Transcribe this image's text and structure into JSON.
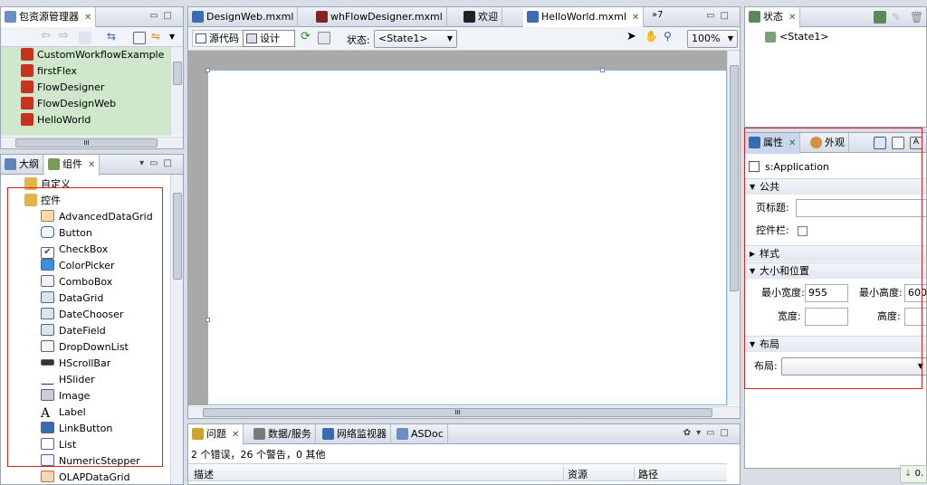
{
  "colors": {
    "selection_green": "#cfe7cb",
    "accent_red": "#e02020",
    "flex_red": "#c8321e",
    "folder": "#e3b34a"
  },
  "package_explorer": {
    "title": "包资源管理器",
    "items": [
      "CustomWorkflowExample",
      "firstFlex",
      "FlowDesigner",
      "FlowDesignWeb",
      "HelloWorld"
    ],
    "hscroll_label": "III"
  },
  "outline_panel": {
    "tabs": [
      "大纲",
      "组件"
    ],
    "folders": [
      "自定义",
      "控件"
    ],
    "components": [
      "AdvancedDataGrid",
      "Button",
      "CheckBox",
      "ColorPicker",
      "ComboBox",
      "DataGrid",
      "DateChooser",
      "DateField",
      "DropDownList",
      "HScrollBar",
      "HSlider",
      "Image",
      "Label",
      "LinkButton",
      "List",
      "NumericStepper",
      "OLAPDataGrid"
    ]
  },
  "editor": {
    "tabs": [
      "DesignWeb.mxml",
      "whFlowDesigner.mxml",
      "欢迎",
      "HelloWorld.mxml"
    ],
    "overflow": "»7",
    "source_label": "源代码",
    "design_label": "设计",
    "state_label": "状态:",
    "state_value": "<State1>",
    "zoom_value": "100%",
    "hscroll_label": "III"
  },
  "problems": {
    "tabs": [
      "问题",
      "数据/服务",
      "网络监视器",
      "ASDoc"
    ],
    "summary": "2 个错误，26 个警告，0 其他",
    "columns": [
      "描述",
      "资源",
      "路径"
    ]
  },
  "states_panel": {
    "title": "状态",
    "items": [
      "<State1>"
    ]
  },
  "properties_panel": {
    "tabs": [
      "属性",
      "外观"
    ],
    "component": "s:Application",
    "sections": {
      "common": "公共",
      "style": "样式",
      "size_position": "大小和位置",
      "layout": "布局"
    },
    "page_title_label": "页标题:",
    "controlbar_label": "控件栏:",
    "min_width_label": "最小宽度:",
    "min_width_value": "955",
    "min_height_label": "最小高度:",
    "min_height_value": "600",
    "width_label": "宽度:",
    "height_label": "高度:",
    "layout_label": "布局:"
  },
  "status_bar": {
    "text": "0."
  }
}
